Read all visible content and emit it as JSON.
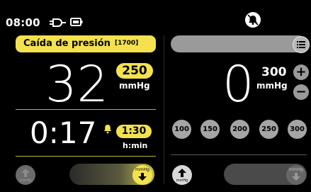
{
  "status": {
    "time": "08:00",
    "icons": [
      "plug-icon",
      "battery-icon",
      "alarm-off-icon"
    ]
  },
  "left": {
    "mode_label": "Caída de presión",
    "mode_code": "[1700]",
    "pressure_value": "32",
    "target_value": "250",
    "unit": "mmHg",
    "timer_value": "0:17",
    "timer_target": "1:30",
    "timer_unit": "h:min",
    "left_icon_label": "mmHg",
    "slider_knob_label": "mmHg"
  },
  "right": {
    "pressure_value": "0",
    "target_value": "300",
    "unit": "mmHg",
    "plus_label": "+",
    "minus_label": "−",
    "presets": [
      "100",
      "150",
      "200",
      "250",
      "300"
    ],
    "right_icon_label": "mmHg",
    "slider_knob_label": "mmHg"
  },
  "colors": {
    "accent_yellow": "#f3e24e",
    "background": "#000000",
    "grey_control": "#9a9a9a"
  }
}
